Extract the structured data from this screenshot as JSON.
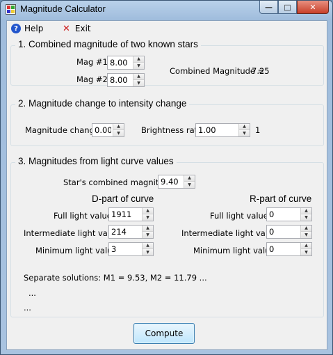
{
  "window": {
    "title": "Magnitude Calculator"
  },
  "menu": {
    "help": "Help",
    "exit": "Exit"
  },
  "section1": {
    "title": "1.  Combined magnitude of two known stars",
    "mag1_label": "Mag #1",
    "mag1_value": "8.00",
    "mag2_label": "Mag #2",
    "mag2_value": "8.00",
    "combined_label": "Combined Magnitude =",
    "combined_value": "7.25"
  },
  "section2": {
    "title": "2. Magnitude change to intensity change",
    "mag_change_label": "Magnitude change",
    "mag_change_value": "0.00",
    "brightness_label": "Brightness ratio",
    "brightness_value": "1.00",
    "brightness_result": "1"
  },
  "section3": {
    "title": "3.  Magnitudes from light curve values",
    "combined_mag_label": "Star's combined magnitude",
    "combined_mag_value": "9.40",
    "d_header": "D-part of curve",
    "r_header": "R-part of curve",
    "full_label": "Full light value",
    "intermediate_label": "Intermediate light value",
    "minimum_label": "Minimum light value",
    "d_full": "1911",
    "d_intermediate": "214",
    "d_minimum": "3",
    "r_full": "0",
    "r_intermediate": "0",
    "r_minimum": "0",
    "solutions_line": "Separate solutions:   M1 = 9.53,   M2 = 11.79   ...",
    "line2": "...",
    "line3": "..."
  },
  "compute_button": "Compute",
  "icons": [
    "app-icon",
    "help-icon",
    "exit-icon",
    "minimize-icon",
    "maximize-icon",
    "close-icon",
    "spin-up-icon",
    "spin-down-icon"
  ]
}
